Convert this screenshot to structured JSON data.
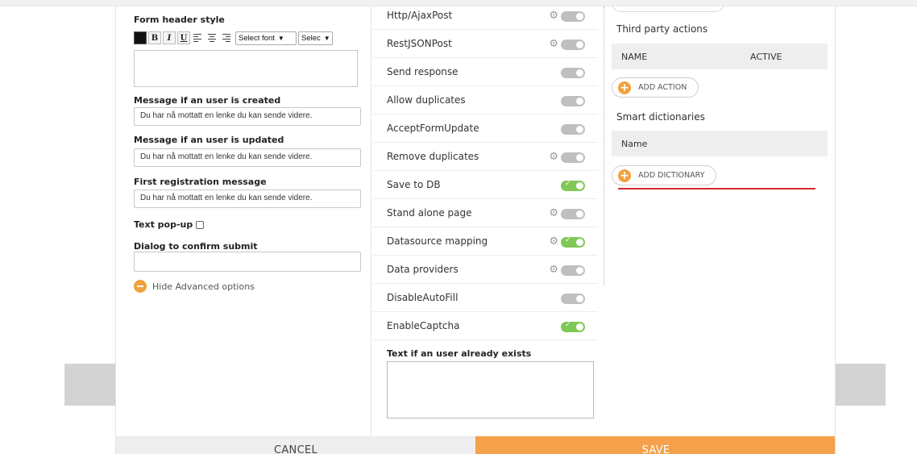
{
  "left": {
    "form_header_style_label": "Form header style",
    "toolbar": {
      "bold": "B",
      "italic": "I",
      "underline": "U",
      "font_select": "Select font",
      "size_select": "Selec"
    },
    "msg_created_label": "Message if an user is created",
    "msg_created_value": "Du har nå mottatt en lenke du kan sende videre.",
    "msg_updated_label": "Message if an user is updated",
    "msg_updated_value": "Du har nå mottatt en lenke du kan sende videre.",
    "first_reg_label": "First registration message",
    "first_reg_value": "Du har nå mottatt en lenke du kan sende videre.",
    "text_popup_label": "Text pop-up",
    "dialog_confirm_label": "Dialog to confirm submit",
    "dialog_confirm_value": "",
    "hide_advanced": "Hide Advanced options"
  },
  "middle": {
    "rows": [
      {
        "label": "Http/AjaxPost",
        "gear": true,
        "on": false
      },
      {
        "label": "RestJSONPost",
        "gear": true,
        "on": false
      },
      {
        "label": "Send response",
        "gear": false,
        "on": false
      },
      {
        "label": "Allow duplicates",
        "gear": false,
        "on": false
      },
      {
        "label": "AcceptFormUpdate",
        "gear": false,
        "on": false
      },
      {
        "label": "Remove duplicates",
        "gear": true,
        "on": false
      },
      {
        "label": "Save to DB",
        "gear": false,
        "on": true
      },
      {
        "label": "Stand alone page",
        "gear": true,
        "on": false
      },
      {
        "label": "Datasource mapping",
        "gear": true,
        "on": true
      },
      {
        "label": "Data providers",
        "gear": true,
        "on": false
      },
      {
        "label": "DisableAutoFill",
        "gear": false,
        "on": false
      },
      {
        "label": "EnableCaptcha",
        "gear": false,
        "on": true
      }
    ],
    "user_exists_label": "Text if an user already exists",
    "user_exists_value": ""
  },
  "right": {
    "third_party_title": "Third party actions",
    "actions_col_name": "NAME",
    "actions_col_active": "ACTIVE",
    "add_action": "ADD ACTION",
    "smart_dict_title": "Smart dictionaries",
    "dict_col_name": "Name",
    "add_dictionary": "ADD DICTIONARY"
  },
  "footer": {
    "cancel": "CANCEL",
    "save": "SAVE"
  },
  "colors": {
    "accent_orange": "#f5a04a",
    "toggle_on": "#7ec856",
    "toggle_off": "#bfbfbf",
    "annotation_red": "#d62a2a"
  }
}
